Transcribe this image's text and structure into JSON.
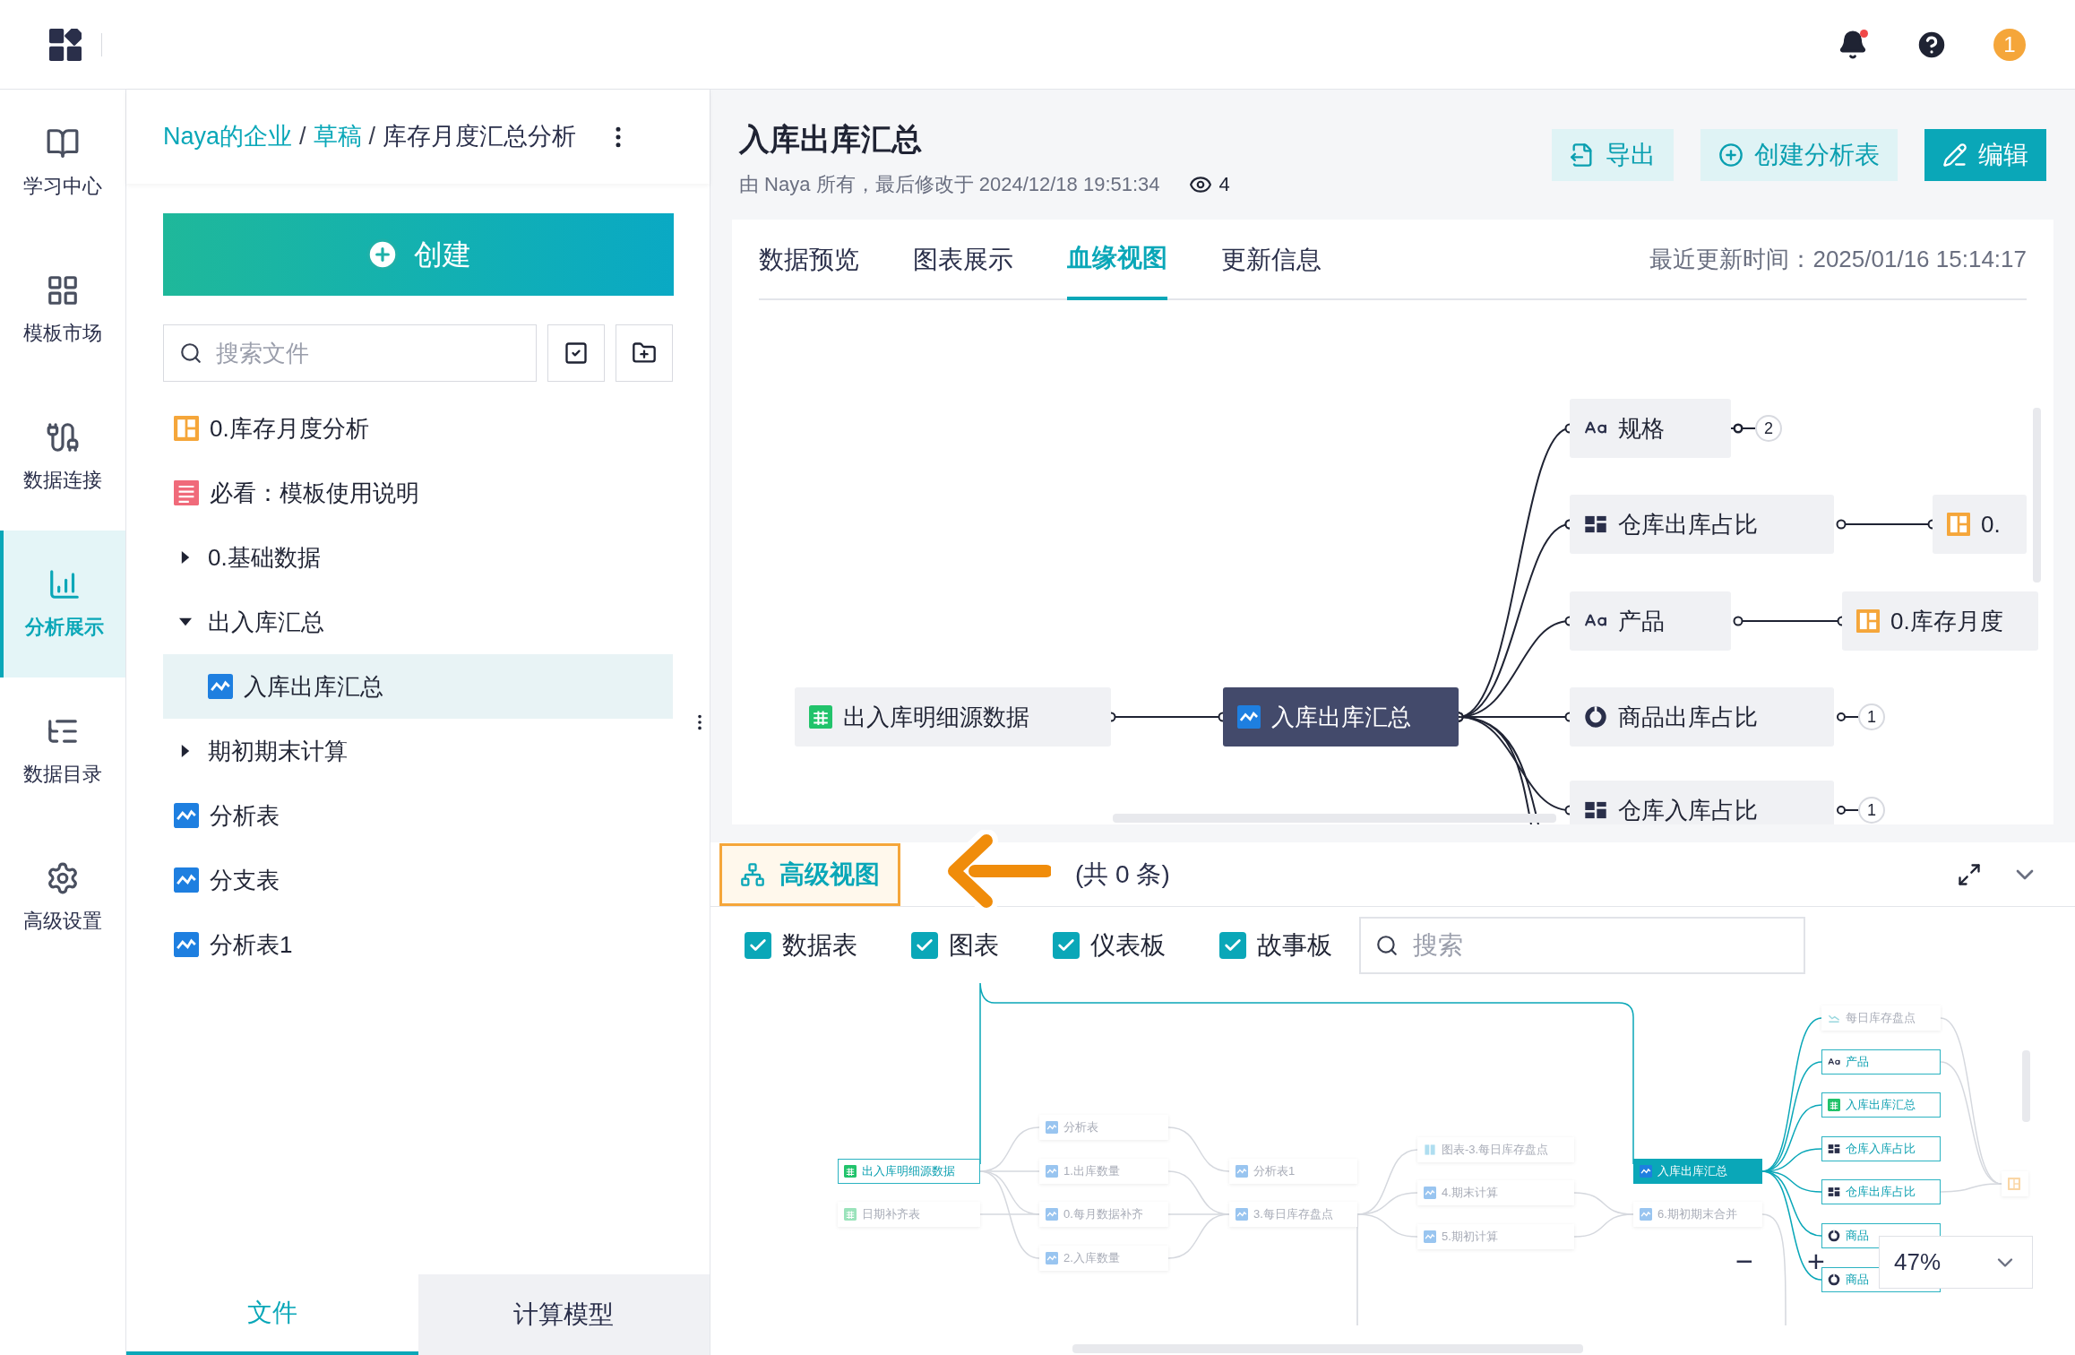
{
  "topbar": {
    "avatar": "1"
  },
  "nav": [
    {
      "label": "学习中心",
      "selected": false
    },
    {
      "label": "模板市场",
      "selected": false
    },
    {
      "label": "数据连接",
      "selected": false
    },
    {
      "label": "分析展示",
      "selected": true
    },
    {
      "label": "数据目录",
      "selected": false
    },
    {
      "label": "高级设置",
      "selected": false
    }
  ],
  "files": {
    "breadcrumb": [
      {
        "label": "Naya的企业",
        "link": true
      },
      {
        "separator": "/",
        "label": "草稿",
        "link": true
      },
      {
        "separator": "/",
        "label": "库存月度汇总分析",
        "link": false
      }
    ],
    "create_button": "创建",
    "search": {
      "placeholder": "搜索文件"
    },
    "tree": [
      {
        "label": "0.库存月度分析",
        "kind": "board",
        "selected": false
      },
      {
        "label": "必看：模板使用说明",
        "kind": "doc",
        "selected": false
      },
      {
        "label": "0.基础数据",
        "kind": "folder",
        "expanded": false,
        "selected": false
      },
      {
        "label": "出入库汇总",
        "kind": "folder",
        "expanded": true,
        "selected": false,
        "children": [
          {
            "label": "入库出库汇总",
            "kind": "chart",
            "selected": true
          }
        ]
      },
      {
        "label": "期初期末计算",
        "kind": "folder",
        "expanded": false,
        "selected": false
      },
      {
        "label": "分析表",
        "kind": "chart",
        "selected": false
      },
      {
        "label": "分支表",
        "kind": "chart",
        "selected": false
      },
      {
        "label": "分析表1",
        "kind": "chart",
        "selected": false
      }
    ],
    "tabs": [
      {
        "label": "文件",
        "selected": true
      },
      {
        "label": "计算模型",
        "selected": false
      }
    ]
  },
  "detail": {
    "title": "入库出库汇总",
    "meta": "由 Naya 所有，最后修改于 2024/12/18 19:51:34",
    "views": "4",
    "actions": [
      {
        "label": "导出",
        "kind": "export"
      },
      {
        "label": "创建分析表",
        "kind": "create"
      },
      {
        "label": "编辑",
        "kind": "edit"
      }
    ],
    "tabs": [
      {
        "label": "数据预览",
        "selected": false
      },
      {
        "label": "图表展示",
        "selected": false
      },
      {
        "label": "血缘视图",
        "selected": true
      },
      {
        "label": "更新信息",
        "selected": false
      }
    ],
    "updated": "最近更新时间：2025/01/16 15:14:17",
    "lineage": [
      {
        "label": "出入库明细源数据",
        "kind": "table",
        "selected": false
      },
      {
        "label": "入库出库汇总",
        "kind": "chart",
        "selected": true
      },
      {
        "label": "规格",
        "kind": "dimension",
        "selected": false,
        "count": "2"
      },
      {
        "label": "仓库出库占比",
        "kind": "dashboard",
        "selected": false
      },
      {
        "label": "0.",
        "kind": "board",
        "selected": false
      },
      {
        "label": "产品",
        "kind": "dimension",
        "selected": false
      },
      {
        "label": "0.库存月度",
        "kind": "board",
        "selected": false
      },
      {
        "label": "商品出库占比",
        "kind": "pie",
        "selected": false,
        "count": "1"
      },
      {
        "label": "仓库入库占比",
        "kind": "dashboard",
        "selected": false,
        "count": "1"
      }
    ]
  },
  "advanced": {
    "button": "高级视图",
    "count_text": "(共 0 条)",
    "filters": [
      {
        "label": "数据表",
        "checked": true
      },
      {
        "label": "图表",
        "checked": true
      },
      {
        "label": "仪表板",
        "checked": true
      },
      {
        "label": "故事板",
        "checked": true
      }
    ],
    "search": {
      "placeholder": "搜索"
    },
    "map": [
      {
        "label": "出入库明细源数据",
        "kind": "table",
        "selected": false,
        "related": true
      },
      {
        "label": "日期补齐表",
        "kind": "table",
        "selected": false,
        "related": false
      },
      {
        "label": "分析表",
        "kind": "chart",
        "selected": false,
        "related": false
      },
      {
        "label": "1.出库数量",
        "kind": "chart",
        "selected": false,
        "related": false
      },
      {
        "label": "0.每月数据补齐",
        "kind": "chart",
        "selected": false,
        "related": false
      },
      {
        "label": "2.入库数量",
        "kind": "chart",
        "selected": false,
        "related": false
      },
      {
        "label": "分析表1",
        "kind": "chart",
        "selected": false,
        "related": false
      },
      {
        "label": "3.每日库存盘点",
        "kind": "chart",
        "selected": false,
        "related": false
      },
      {
        "label": "图表-3.每日库存盘点",
        "kind": "columns",
        "selected": false,
        "related": false
      },
      {
        "label": "4.期末计算",
        "kind": "chart",
        "selected": false,
        "related": false
      },
      {
        "label": "5.期初计算",
        "kind": "chart",
        "selected": false,
        "related": false
      },
      {
        "label": "入库出库汇总",
        "kind": "chart",
        "selected": true,
        "related": false
      },
      {
        "label": "6.期初期末合并",
        "kind": "chart",
        "selected": false,
        "related": false
      },
      {
        "label": "每日库存盘点",
        "kind": "trend",
        "selected": false,
        "related": false
      },
      {
        "label": "产品",
        "kind": "dimension",
        "selected": false,
        "related": true
      },
      {
        "label": "入库出库汇总",
        "kind": "table",
        "selected": false,
        "related": true
      },
      {
        "label": "仓库入库占比",
        "kind": "dashboard",
        "selected": false,
        "related": true
      },
      {
        "label": "仓库出库占比",
        "kind": "dashboard",
        "selected": false,
        "related": true
      },
      {
        "label": "商品",
        "kind": "pie",
        "selected": false,
        "related": true
      },
      {
        "label": "商品",
        "kind": "pie",
        "selected": false,
        "related": true
      },
      {
        "kind": "board",
        "selected": false,
        "related": false
      }
    ],
    "zoom": {
      "minus": "−",
      "plus": "+",
      "value": "47%"
    }
  }
}
